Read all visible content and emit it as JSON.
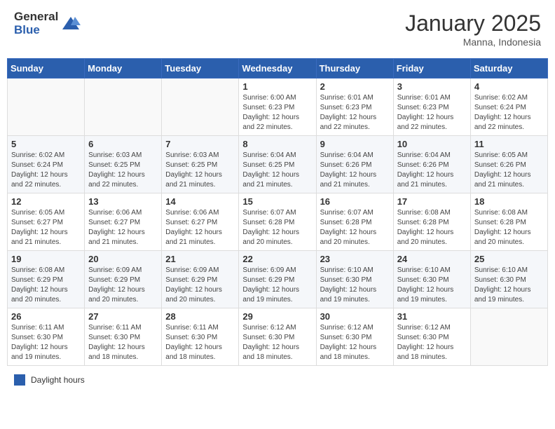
{
  "header": {
    "logo_general": "General",
    "logo_blue": "Blue",
    "month_title": "January 2025",
    "location": "Manna, Indonesia"
  },
  "days_of_week": [
    "Sunday",
    "Monday",
    "Tuesday",
    "Wednesday",
    "Thursday",
    "Friday",
    "Saturday"
  ],
  "weeks": [
    [
      {
        "day": "",
        "info": ""
      },
      {
        "day": "",
        "info": ""
      },
      {
        "day": "",
        "info": ""
      },
      {
        "day": "1",
        "info": "Sunrise: 6:00 AM\nSunset: 6:23 PM\nDaylight: 12 hours\nand 22 minutes."
      },
      {
        "day": "2",
        "info": "Sunrise: 6:01 AM\nSunset: 6:23 PM\nDaylight: 12 hours\nand 22 minutes."
      },
      {
        "day": "3",
        "info": "Sunrise: 6:01 AM\nSunset: 6:23 PM\nDaylight: 12 hours\nand 22 minutes."
      },
      {
        "day": "4",
        "info": "Sunrise: 6:02 AM\nSunset: 6:24 PM\nDaylight: 12 hours\nand 22 minutes."
      }
    ],
    [
      {
        "day": "5",
        "info": "Sunrise: 6:02 AM\nSunset: 6:24 PM\nDaylight: 12 hours\nand 22 minutes."
      },
      {
        "day": "6",
        "info": "Sunrise: 6:03 AM\nSunset: 6:25 PM\nDaylight: 12 hours\nand 22 minutes."
      },
      {
        "day": "7",
        "info": "Sunrise: 6:03 AM\nSunset: 6:25 PM\nDaylight: 12 hours\nand 21 minutes."
      },
      {
        "day": "8",
        "info": "Sunrise: 6:04 AM\nSunset: 6:25 PM\nDaylight: 12 hours\nand 21 minutes."
      },
      {
        "day": "9",
        "info": "Sunrise: 6:04 AM\nSunset: 6:26 PM\nDaylight: 12 hours\nand 21 minutes."
      },
      {
        "day": "10",
        "info": "Sunrise: 6:04 AM\nSunset: 6:26 PM\nDaylight: 12 hours\nand 21 minutes."
      },
      {
        "day": "11",
        "info": "Sunrise: 6:05 AM\nSunset: 6:26 PM\nDaylight: 12 hours\nand 21 minutes."
      }
    ],
    [
      {
        "day": "12",
        "info": "Sunrise: 6:05 AM\nSunset: 6:27 PM\nDaylight: 12 hours\nand 21 minutes."
      },
      {
        "day": "13",
        "info": "Sunrise: 6:06 AM\nSunset: 6:27 PM\nDaylight: 12 hours\nand 21 minutes."
      },
      {
        "day": "14",
        "info": "Sunrise: 6:06 AM\nSunset: 6:27 PM\nDaylight: 12 hours\nand 21 minutes."
      },
      {
        "day": "15",
        "info": "Sunrise: 6:07 AM\nSunset: 6:28 PM\nDaylight: 12 hours\nand 20 minutes."
      },
      {
        "day": "16",
        "info": "Sunrise: 6:07 AM\nSunset: 6:28 PM\nDaylight: 12 hours\nand 20 minutes."
      },
      {
        "day": "17",
        "info": "Sunrise: 6:08 AM\nSunset: 6:28 PM\nDaylight: 12 hours\nand 20 minutes."
      },
      {
        "day": "18",
        "info": "Sunrise: 6:08 AM\nSunset: 6:28 PM\nDaylight: 12 hours\nand 20 minutes."
      }
    ],
    [
      {
        "day": "19",
        "info": "Sunrise: 6:08 AM\nSunset: 6:29 PM\nDaylight: 12 hours\nand 20 minutes."
      },
      {
        "day": "20",
        "info": "Sunrise: 6:09 AM\nSunset: 6:29 PM\nDaylight: 12 hours\nand 20 minutes."
      },
      {
        "day": "21",
        "info": "Sunrise: 6:09 AM\nSunset: 6:29 PM\nDaylight: 12 hours\nand 20 minutes."
      },
      {
        "day": "22",
        "info": "Sunrise: 6:09 AM\nSunset: 6:29 PM\nDaylight: 12 hours\nand 19 minutes."
      },
      {
        "day": "23",
        "info": "Sunrise: 6:10 AM\nSunset: 6:30 PM\nDaylight: 12 hours\nand 19 minutes."
      },
      {
        "day": "24",
        "info": "Sunrise: 6:10 AM\nSunset: 6:30 PM\nDaylight: 12 hours\nand 19 minutes."
      },
      {
        "day": "25",
        "info": "Sunrise: 6:10 AM\nSunset: 6:30 PM\nDaylight: 12 hours\nand 19 minutes."
      }
    ],
    [
      {
        "day": "26",
        "info": "Sunrise: 6:11 AM\nSunset: 6:30 PM\nDaylight: 12 hours\nand 19 minutes."
      },
      {
        "day": "27",
        "info": "Sunrise: 6:11 AM\nSunset: 6:30 PM\nDaylight: 12 hours\nand 18 minutes."
      },
      {
        "day": "28",
        "info": "Sunrise: 6:11 AM\nSunset: 6:30 PM\nDaylight: 12 hours\nand 18 minutes."
      },
      {
        "day": "29",
        "info": "Sunrise: 6:12 AM\nSunset: 6:30 PM\nDaylight: 12 hours\nand 18 minutes."
      },
      {
        "day": "30",
        "info": "Sunrise: 6:12 AM\nSunset: 6:30 PM\nDaylight: 12 hours\nand 18 minutes."
      },
      {
        "day": "31",
        "info": "Sunrise: 6:12 AM\nSunset: 6:30 PM\nDaylight: 12 hours\nand 18 minutes."
      },
      {
        "day": "",
        "info": ""
      }
    ]
  ],
  "legend": {
    "label": "Daylight hours"
  }
}
